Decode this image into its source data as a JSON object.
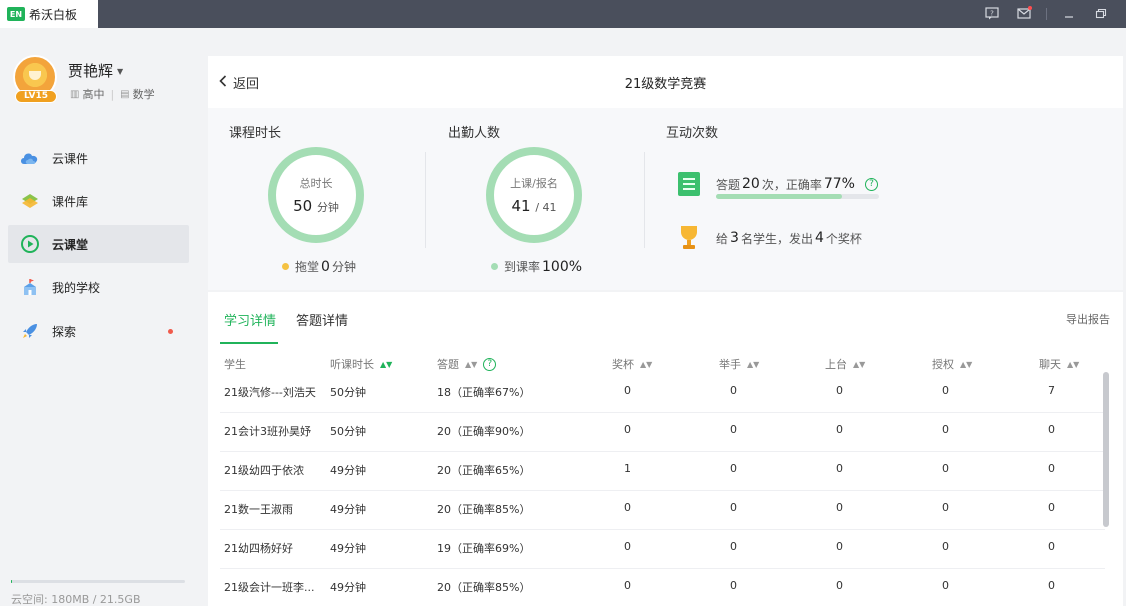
{
  "app": {
    "logo": "EN",
    "title": "希沃白板"
  },
  "user": {
    "name": "贾艳辉",
    "level": "LV15",
    "grade": "高中",
    "subject": "数学"
  },
  "nav": [
    {
      "label": "云课件",
      "icon": "cloud-icon"
    },
    {
      "label": "课件库",
      "icon": "library-icon"
    },
    {
      "label": "云课堂",
      "icon": "play-icon",
      "active": true
    },
    {
      "label": "我的学校",
      "icon": "school-icon"
    },
    {
      "label": "探索",
      "icon": "rocket-icon",
      "dot": true
    }
  ],
  "storage": {
    "text": "云空间:   180MB / 21.5GB",
    "used_fraction": 0.008
  },
  "header": {
    "back_label": "返回",
    "title": "21级数学竞赛"
  },
  "stats": {
    "duration": {
      "label": "课程时长",
      "ring_caption": "总时长",
      "value": "50",
      "unit": "分钟",
      "legend_label": "拖堂",
      "legend_value": "0",
      "legend_unit": "分钟"
    },
    "attendance": {
      "label": "出勤人数",
      "ring_caption": "上课/报名",
      "value": "41",
      "total": "/ 41",
      "legend_label": "到课率",
      "legend_value": "100%"
    },
    "interaction": {
      "label": "互动次数",
      "answers_prefix": "答题",
      "answers_count": "20",
      "answers_mid": "次，正确率",
      "accuracy": "77%",
      "accuracy_fraction": 0.77,
      "award_prefix": "给",
      "award_students": "3",
      "award_mid": "名学生，发出",
      "award_count": "4",
      "award_suffix": "个奖杯"
    }
  },
  "detail": {
    "tabs": [
      "学习详情",
      "答题详情"
    ],
    "export_label": "导出报告",
    "columns": [
      "学生",
      "听课时长",
      "答题",
      "奖杯",
      "举手",
      "上台",
      "授权",
      "聊天"
    ],
    "rows": [
      [
        "21级汽修---刘浩天",
        "50分钟",
        "18（正确率67%）",
        "0",
        "0",
        "0",
        "0",
        "7"
      ],
      [
        "21会计3班孙昊妤",
        "50分钟",
        "20（正确率90%）",
        "0",
        "0",
        "0",
        "0",
        "0"
      ],
      [
        "21级幼四于依浓",
        "49分钟",
        "20（正确率65%）",
        "1",
        "0",
        "0",
        "0",
        "0"
      ],
      [
        "21数一王淑雨",
        "49分钟",
        "20（正确率85%）",
        "0",
        "0",
        "0",
        "0",
        "0"
      ],
      [
        "21幼四杨好好",
        "49分钟",
        "19（正确率69%）",
        "0",
        "0",
        "0",
        "0",
        "0"
      ],
      [
        "21级会计一班李...",
        "49分钟",
        "20（正确率85%）",
        "0",
        "0",
        "0",
        "0",
        "0"
      ]
    ]
  },
  "colors": {
    "accent": "#20b35a",
    "ring": "#a4ddb4",
    "titlebar": "#4a4f5c"
  }
}
